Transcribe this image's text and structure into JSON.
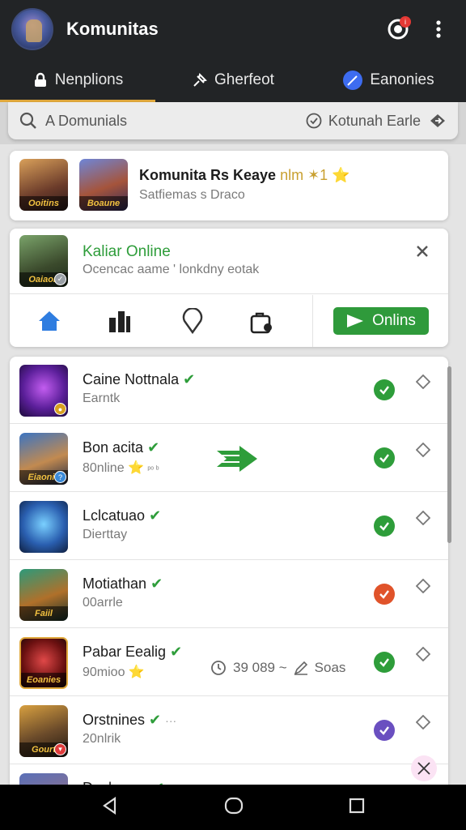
{
  "header": {
    "title": "Komunitas",
    "notification_count": "i"
  },
  "tabs": [
    {
      "label": "Nenplions",
      "icon": "lock-icon",
      "active": true
    },
    {
      "label": "Gherfeot",
      "icon": "pin-icon",
      "active": false
    },
    {
      "label": "Eanonies",
      "icon": "feather-icon",
      "active": false
    }
  ],
  "search": {
    "placeholder": "A Domunials",
    "filter_label": "Kotunah Earle"
  },
  "promo_card": {
    "title": "Komunita Rs Keaye ",
    "title_extra": "nlm ✶1 ⭐",
    "subtitle": "Satfiemas s Draco",
    "thumb1_caption": "Ooitins",
    "thumb2_caption": "Boaune"
  },
  "live_card": {
    "title": "Kaliar Online",
    "subtitle": "Ocencac aame ' lonkdny eotak",
    "thumb_caption": "Oaiaon",
    "online_button": "Onlins",
    "nav_icons": [
      "home-icon",
      "leaderboard-icon",
      "location-icon",
      "bag-icon"
    ]
  },
  "list": [
    {
      "name": "Caine Nottnala",
      "sub": "Earntk",
      "status": "green",
      "caption": ""
    },
    {
      "name": "Bon acita",
      "sub": "80nline ⭐",
      "sub_extra": "ᵖᵒ ᵇ",
      "status": "green",
      "caption": "Eiaonie"
    },
    {
      "name": "Lclcatuao",
      "sub": "Dierttay",
      "status": "green",
      "caption": ""
    },
    {
      "name": "Motiathan",
      "sub": "00arrle",
      "status": "orange",
      "caption": "Faiil"
    },
    {
      "name": "Pabar Eealig",
      "sub": "90mioo ⭐",
      "extra": "39 089 ~",
      "extra2": "Soas",
      "status": "green",
      "caption": "Eoanies"
    },
    {
      "name": "Orstnines",
      "sub": "20nlrik",
      "extra": "···",
      "status": "purple",
      "caption": "Gourt"
    },
    {
      "name": "Dochenes",
      "sub": "",
      "status": "",
      "caption": ""
    }
  ],
  "colors": {
    "appbar": "#222426",
    "accent_tab": "#e0a83c",
    "online_green": "#2f9a3b",
    "status_green": "#2e9d3a",
    "status_orange": "#e0532a",
    "status_purple": "#6a4fc0"
  }
}
